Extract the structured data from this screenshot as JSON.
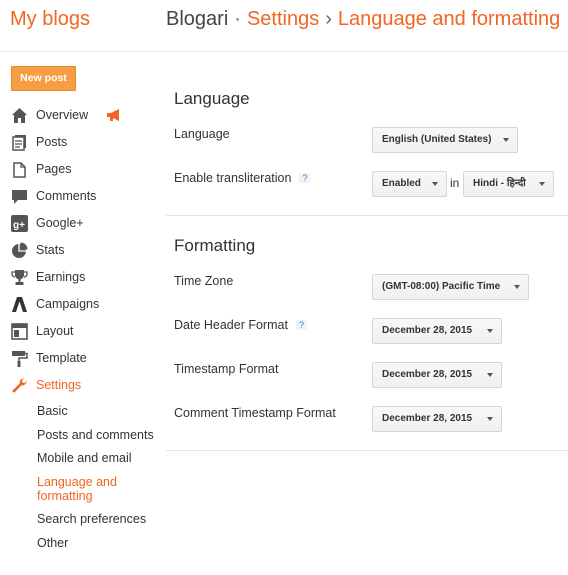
{
  "header": {
    "logo": "My blogs",
    "blog_name": "Blogari",
    "sep1": "·",
    "settings_link": "Settings",
    "sep2": "›",
    "page_link": "Language and formatting"
  },
  "new_post_label": "New post",
  "nav": {
    "items": [
      {
        "label": "Overview",
        "icon": "home-icon"
      },
      {
        "label": "Posts",
        "icon": "posts-icon"
      },
      {
        "label": "Pages",
        "icon": "pages-icon"
      },
      {
        "label": "Comments",
        "icon": "comment-icon"
      },
      {
        "label": "Google+",
        "icon": "google-plus-icon"
      },
      {
        "label": "Stats",
        "icon": "pie-chart-icon"
      },
      {
        "label": "Earnings",
        "icon": "trophy-icon"
      },
      {
        "label": "Campaigns",
        "icon": "adwords-icon"
      },
      {
        "label": "Layout",
        "icon": "layout-icon"
      },
      {
        "label": "Template",
        "icon": "paint-roller-icon"
      },
      {
        "label": "Settings",
        "icon": "wrench-icon",
        "active": true
      }
    ],
    "settings_sub": [
      {
        "label": "Basic"
      },
      {
        "label": "Posts and comments"
      },
      {
        "label": "Mobile and email"
      },
      {
        "label": "Language and formatting",
        "active": true
      },
      {
        "label": "Search preferences"
      },
      {
        "label": "Other"
      }
    ]
  },
  "language_section": {
    "title": "Language",
    "language_label": "Language",
    "language_value": "English (United States)",
    "translit_label": "Enable transliteration",
    "translit_help": "?",
    "translit_value": "Enabled",
    "in_label": "in",
    "translit_lang": "Hindi - हिन्दी"
  },
  "formatting_section": {
    "title": "Formatting",
    "timezone_label": "Time Zone",
    "timezone_value": "(GMT-08:00) Pacific Time",
    "date_header_label": "Date Header Format",
    "date_header_help": "?",
    "date_header_value": "December 28, 2015",
    "timestamp_label": "Timestamp Format",
    "timestamp_value": "December 28, 2015",
    "comment_timestamp_label": "Comment Timestamp Format",
    "comment_timestamp_value": "December 28, 2015"
  },
  "colors": {
    "accent": "#f26522",
    "button": "#f79e45",
    "icon": "#555555"
  }
}
